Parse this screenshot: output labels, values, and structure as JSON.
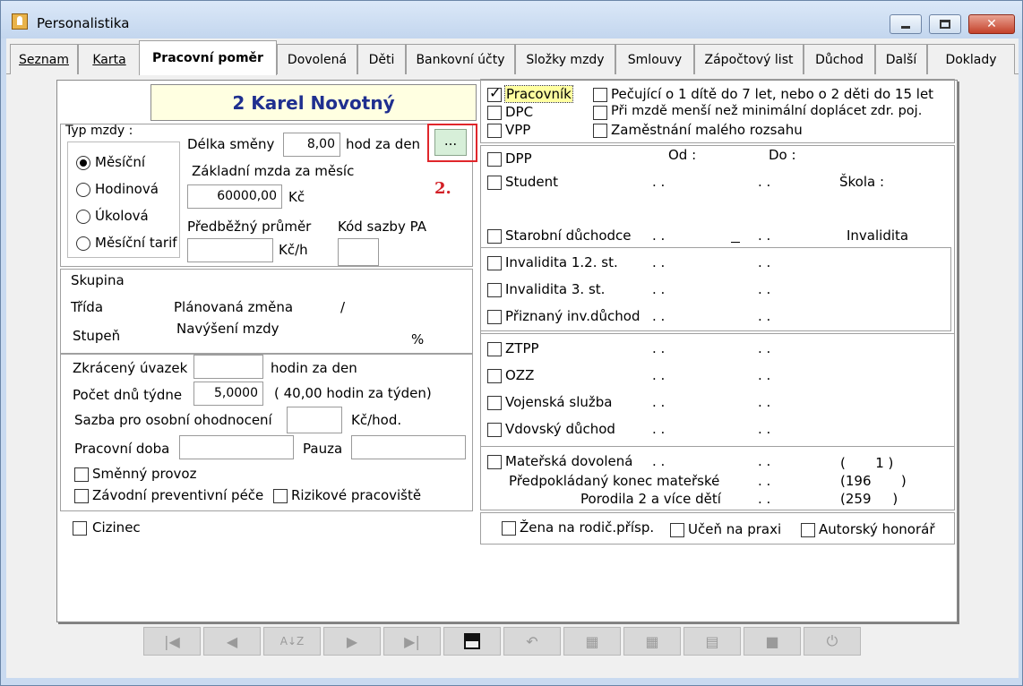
{
  "window": {
    "title": "Personalistika",
    "close_glyph": "✕"
  },
  "tabs": [
    "Seznam",
    "Karta",
    "Pracovní poměr",
    "Dovolená",
    "Děti",
    "Bankovní účty",
    "Složky mzdy",
    "Smlouvy",
    "Zápočtový list",
    "Důchod",
    "Další",
    "Doklady"
  ],
  "active_tab": "Pracovní poměr",
  "employee": {
    "name": "2 Karel Novotný"
  },
  "wage_type": {
    "label": "Typ mzdy :",
    "options": [
      "Měsíční",
      "Hodinová",
      "Úkolová",
      "Měsíční tarif"
    ],
    "selected": "Měsíční",
    "shift_length_label": "Délka směny",
    "shift_length_value": "8,00",
    "shift_unit": "hod za den",
    "ellipsis_button": "...",
    "annotation": "2.",
    "base_wage_label": "Základní mzda za měsíc",
    "base_wage_value": "60000,00",
    "base_wage_unit": "Kč",
    "avg_label": "Předběžný průměr",
    "avg_value": "",
    "avg_unit": "Kč/h",
    "rate_code_label": "Kód sazby PA",
    "rate_code_value": ""
  },
  "group": {
    "skupina": "Skupina",
    "trida": "Třída",
    "stupen": "Stupeň",
    "planned_change": "Plánovaná změna",
    "slash": "/",
    "increase": "Navýšení mzdy",
    "percent": "%"
  },
  "hours": {
    "reduced_label": "Zkrácený úvazek",
    "reduced_value": "",
    "reduced_unit": "hodin za den",
    "days_label": "Počet dnů  týdne",
    "days_value": "5,0000",
    "days_note": "( 40,00 hodin za týden)",
    "rate_label": "Sazba pro osobní ohodnocení",
    "rate_value": "",
    "rate_unit": "Kč/hod.",
    "work_time_label": "Pracovní doba",
    "work_time_value": "",
    "pause_label": "Pauza",
    "pause_value": "",
    "shift_work": "Směnný provoz",
    "preventive_care": "Závodní preventivní péče",
    "risky_workplace": "Rizikové pracoviště"
  },
  "foreigner": "Cizinec",
  "employment_types": {
    "pracovnik": "Pracovník",
    "dpc": "DPC",
    "vpp": "VPP",
    "caregiver": "Pečující o 1 dítě do 7 let, nebo o 2 děti do 15 let",
    "min_wage": "Při mzdě menší než minimální doplácet zdr. poj.",
    "small_scope": "Zaměstnání malého rozsahu"
  },
  "statuses": {
    "from_label": "Od :",
    "to_label": "Do :",
    "school_label": "Škola :",
    "invalidity_header": "Invalidita",
    "dots": ". .",
    "dpp": "DPP",
    "student": "Student",
    "old_age": "Starobní důchodce",
    "inv12": "Invalidita 1.2. st.",
    "inv3": "Invalidita 3. st.",
    "inv_pension": "Přiznaný inv.důchod",
    "ztpp": "ZTPP",
    "ozz": "OZZ",
    "military": "Vojenská služba",
    "widow": "Vdovský důchod",
    "maternity": "Mateřská dovolená",
    "expected_end": "Předpokládaný konec mateřské",
    "twins": "Porodila 2 a více dětí",
    "maternity_num": "(       1 )",
    "expected_num": "(196       )",
    "twins_num": "(259     )"
  },
  "bottom_checks": {
    "parental": "Žena na rodič.přísp.",
    "apprentice": "Učeň na praxi",
    "author_fee": "Autorský honorář"
  },
  "toolbar": {
    "first": "|◀",
    "prev": "◀",
    "sort": "A↓Z",
    "next": "▶",
    "last": "▶|",
    "save": "💾",
    "undo": "↶",
    "b8": "▦",
    "b9": "▦",
    "print": "▤",
    "b11": "■",
    "power": "⏻"
  }
}
